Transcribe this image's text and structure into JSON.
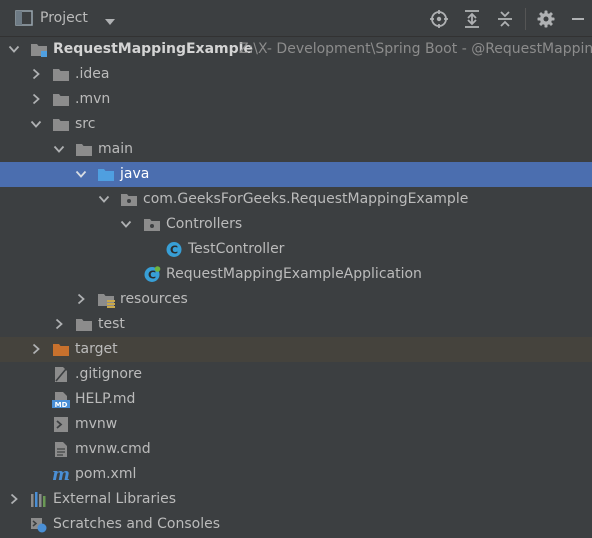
{
  "toolbar": {
    "title": "Project",
    "icons": [
      "project-view-icon",
      "chevron-down-icon",
      "locate-icon",
      "expand-all-icon",
      "collapse-all-icon",
      "gear-icon",
      "minimize-icon"
    ]
  },
  "tree": {
    "root": {
      "label": "RequestMappingExample",
      "path": "Z:\\X- Development\\Spring Boot - @RequestMapping\\"
    },
    "idea": ".idea",
    "mvn": ".mvn",
    "src": "src",
    "main": "main",
    "java": "java",
    "package": "com.GeeksForGeeks.RequestMappingExample",
    "controllers": "Controllers",
    "test_controller": "TestController",
    "application": "RequestMappingExampleApplication",
    "resources": "resources",
    "test": "test",
    "target": "target",
    "gitignore": ".gitignore",
    "help": "HELP.md",
    "mvnw": "mvnw",
    "mvnw_cmd": "mvnw.cmd",
    "pom": "pom.xml",
    "external_libraries": "External Libraries",
    "scratches": "Scratches and Consoles"
  },
  "colors": {
    "background": "#3c3f41",
    "selection": "#4b6eaf",
    "excluded": "#45433d",
    "folder": "#8c8c8c",
    "source_folder": "#4f9fe0",
    "excluded_folder": "#c8712d",
    "class_icon": "#389fd6",
    "maven": "#4a8fd6"
  }
}
